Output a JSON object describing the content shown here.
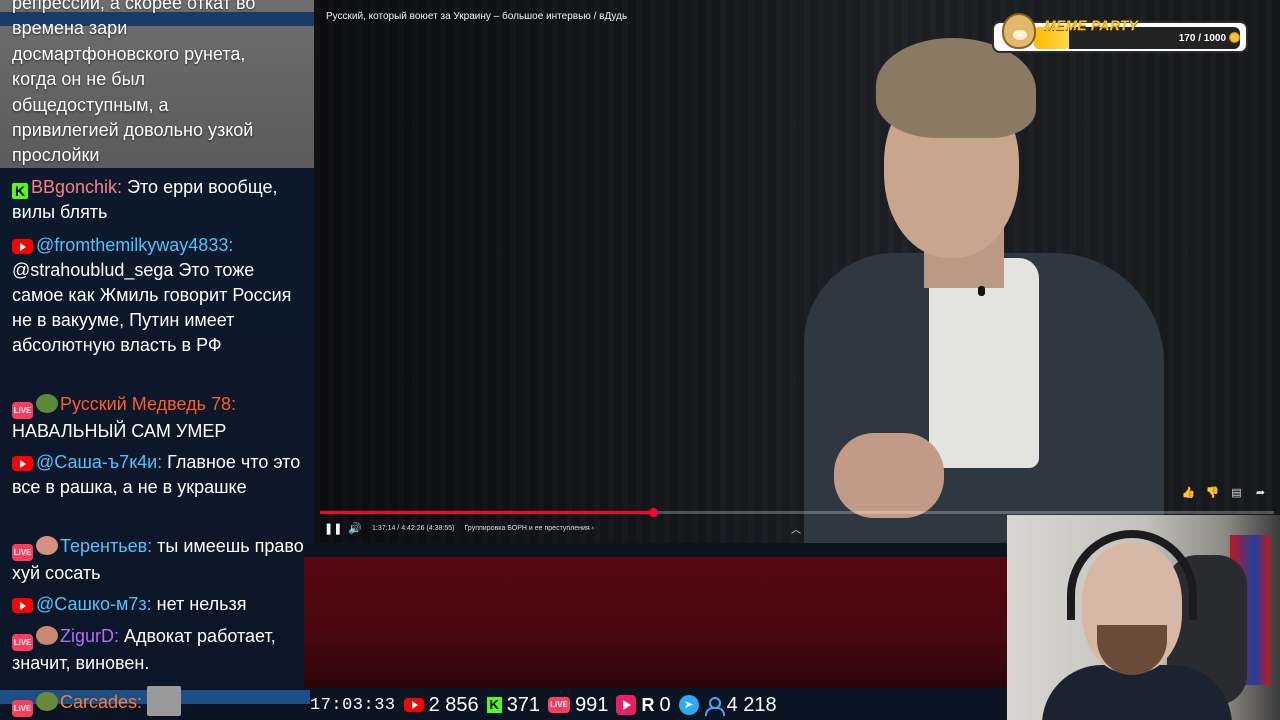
{
  "video": {
    "title": "Русский, который воюет за Украину – большое интервью / вДудь",
    "time": "1:37:14 / 4:42:26 (4:38:55)",
    "chapter": "Группировка БОРН и ее преступления",
    "chapter_arrow": "›",
    "progress_played": 0.349,
    "icons": [
      "play-pause-icon",
      "volume-icon",
      "chevron-up-icon",
      "like-icon",
      "dislike-icon",
      "comment-icon",
      "share-icon"
    ]
  },
  "meme_party": {
    "title": "MEME PARTY",
    "count": "170 / 1000",
    "fill": 0.17,
    "accent": "#ffc21a"
  },
  "chat": {
    "highlight_text": "репрессий, а скорее откат во\nвремена зари\nдосмартфоновского рунета,\nкогда он не был\nобщедоступным, а\nпривилегией довольно узкой\nпрослойки",
    "messages": [
      {
        "platform": "kick",
        "author": "BBgonchik:",
        "color": "#ff7a8a",
        "text": "Это ерри вообще, вилы блять"
      },
      {
        "platform": "youtube",
        "author": "@fromthemilkyway4833:",
        "color": "#4fc3ff",
        "text": "@strahoublud_sega Это тоже самое как Жмиль говорит Россия не в вакууме, Путин имеет абсолютную власть в РФ"
      },
      {
        "platform": "live",
        "author": "Русский Медведь 78:",
        "color": "#ff5a2a",
        "text": "НАВАЛЬНЫЙ САМ УМЕР"
      },
      {
        "platform": "youtube",
        "author": "@Саша-ъ7к4и:",
        "color": "#4fc3ff",
        "text": "Главное что это все в рашка, а не в украшке"
      },
      {
        "platform": "live",
        "author": "Терентьев:",
        "color": "#4fc3ff",
        "text": "ты имеешь право хуй сосать"
      },
      {
        "platform": "youtube",
        "author": "@Сашко-м7з:",
        "color": "#4fc3ff",
        "text": "нет нельзя"
      },
      {
        "platform": "live",
        "author": "ZigurD:",
        "color": "#b06bff",
        "text": "Адвокат работает, значит, виновен."
      },
      {
        "platform": "live",
        "author": "Carcades:",
        "color": "#ff7a3a",
        "text": ""
      }
    ],
    "live_badge": "LIVE",
    "kick_badge": "K"
  },
  "stats": {
    "time": "17:03:33",
    "youtube": "2 856",
    "kick": "371",
    "live": "991",
    "live_badge": "LIVE",
    "play": "0",
    "rumble_letter": "R",
    "telegram": "4 218"
  }
}
